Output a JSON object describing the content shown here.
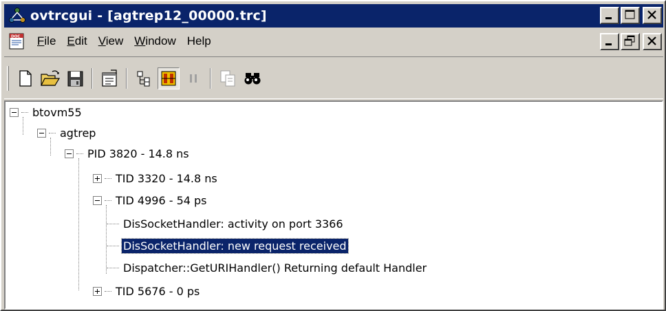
{
  "window": {
    "title": "ovtrcgui - [agtrep12_00000.trc]",
    "icon": "app-network-icon"
  },
  "menu": [
    {
      "label": "File",
      "underline": "F",
      "rest": "ile"
    },
    {
      "label": "Edit",
      "underline": "E",
      "rest": "dit"
    },
    {
      "label": "View",
      "underline": "V",
      "rest": "iew"
    },
    {
      "label": "Window",
      "underline": "W",
      "rest": "indow"
    },
    {
      "label": "Help",
      "underline": "",
      "rest": "Help"
    }
  ],
  "toolbar": {
    "buttons": [
      "new-icon",
      "open-folder-icon",
      "save-icon",
      "properties-icon",
      "tree-view-icon",
      "highlight-icon",
      "pause-icon",
      "copy-icon",
      "find-icon"
    ]
  },
  "tree": {
    "nodes": [
      {
        "label": "btovm55",
        "expander": "minus"
      },
      {
        "label": "agtrep",
        "expander": "minus"
      },
      {
        "label": "PID 3820 - 14.8 ns",
        "expander": "minus"
      },
      {
        "label": "TID 3320 - 14.8 ns",
        "expander": "plus"
      },
      {
        "label": "TID 4996 - 54 ps",
        "expander": "minus"
      },
      {
        "label": "DisSocketHandler: activity on port 3366",
        "expander": "none"
      },
      {
        "label": "DisSocketHandler: new request received",
        "expander": "none",
        "selected": true
      },
      {
        "label": "Dispatcher::GetURIHandler() Returning default Handler",
        "expander": "none"
      },
      {
        "label": "TID 5676 - 0 ps",
        "expander": "plus"
      }
    ]
  },
  "colors": {
    "titlebar": "#0a246a",
    "selection": "#0a246a",
    "face": "#d4d0c8"
  }
}
